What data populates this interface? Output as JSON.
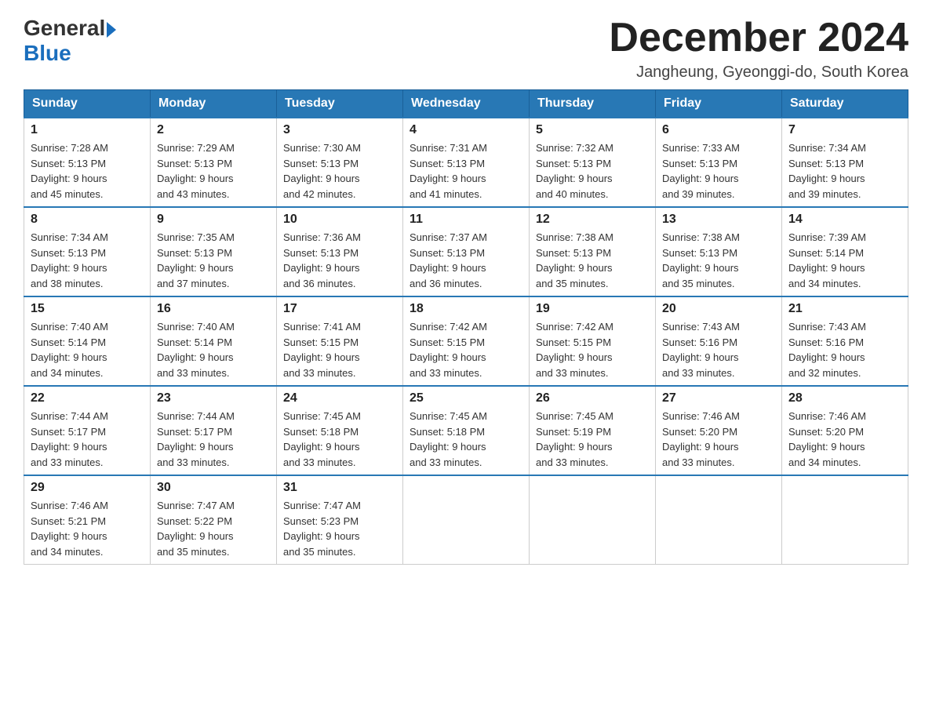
{
  "header": {
    "logo_general": "General",
    "logo_blue": "Blue",
    "month_title": "December 2024",
    "location": "Jangheung, Gyeonggi-do, South Korea"
  },
  "weekdays": [
    "Sunday",
    "Monday",
    "Tuesday",
    "Wednesday",
    "Thursday",
    "Friday",
    "Saturday"
  ],
  "weeks": [
    [
      {
        "day": "1",
        "sunrise": "7:28 AM",
        "sunset": "5:13 PM",
        "daylight": "9 hours and 45 minutes."
      },
      {
        "day": "2",
        "sunrise": "7:29 AM",
        "sunset": "5:13 PM",
        "daylight": "9 hours and 43 minutes."
      },
      {
        "day": "3",
        "sunrise": "7:30 AM",
        "sunset": "5:13 PM",
        "daylight": "9 hours and 42 minutes."
      },
      {
        "day": "4",
        "sunrise": "7:31 AM",
        "sunset": "5:13 PM",
        "daylight": "9 hours and 41 minutes."
      },
      {
        "day": "5",
        "sunrise": "7:32 AM",
        "sunset": "5:13 PM",
        "daylight": "9 hours and 40 minutes."
      },
      {
        "day": "6",
        "sunrise": "7:33 AM",
        "sunset": "5:13 PM",
        "daylight": "9 hours and 39 minutes."
      },
      {
        "day": "7",
        "sunrise": "7:34 AM",
        "sunset": "5:13 PM",
        "daylight": "9 hours and 39 minutes."
      }
    ],
    [
      {
        "day": "8",
        "sunrise": "7:34 AM",
        "sunset": "5:13 PM",
        "daylight": "9 hours and 38 minutes."
      },
      {
        "day": "9",
        "sunrise": "7:35 AM",
        "sunset": "5:13 PM",
        "daylight": "9 hours and 37 minutes."
      },
      {
        "day": "10",
        "sunrise": "7:36 AM",
        "sunset": "5:13 PM",
        "daylight": "9 hours and 36 minutes."
      },
      {
        "day": "11",
        "sunrise": "7:37 AM",
        "sunset": "5:13 PM",
        "daylight": "9 hours and 36 minutes."
      },
      {
        "day": "12",
        "sunrise": "7:38 AM",
        "sunset": "5:13 PM",
        "daylight": "9 hours and 35 minutes."
      },
      {
        "day": "13",
        "sunrise": "7:38 AM",
        "sunset": "5:13 PM",
        "daylight": "9 hours and 35 minutes."
      },
      {
        "day": "14",
        "sunrise": "7:39 AM",
        "sunset": "5:14 PM",
        "daylight": "9 hours and 34 minutes."
      }
    ],
    [
      {
        "day": "15",
        "sunrise": "7:40 AM",
        "sunset": "5:14 PM",
        "daylight": "9 hours and 34 minutes."
      },
      {
        "day": "16",
        "sunrise": "7:40 AM",
        "sunset": "5:14 PM",
        "daylight": "9 hours and 33 minutes."
      },
      {
        "day": "17",
        "sunrise": "7:41 AM",
        "sunset": "5:15 PM",
        "daylight": "9 hours and 33 minutes."
      },
      {
        "day": "18",
        "sunrise": "7:42 AM",
        "sunset": "5:15 PM",
        "daylight": "9 hours and 33 minutes."
      },
      {
        "day": "19",
        "sunrise": "7:42 AM",
        "sunset": "5:15 PM",
        "daylight": "9 hours and 33 minutes."
      },
      {
        "day": "20",
        "sunrise": "7:43 AM",
        "sunset": "5:16 PM",
        "daylight": "9 hours and 33 minutes."
      },
      {
        "day": "21",
        "sunrise": "7:43 AM",
        "sunset": "5:16 PM",
        "daylight": "9 hours and 32 minutes."
      }
    ],
    [
      {
        "day": "22",
        "sunrise": "7:44 AM",
        "sunset": "5:17 PM",
        "daylight": "9 hours and 33 minutes."
      },
      {
        "day": "23",
        "sunrise": "7:44 AM",
        "sunset": "5:17 PM",
        "daylight": "9 hours and 33 minutes."
      },
      {
        "day": "24",
        "sunrise": "7:45 AM",
        "sunset": "5:18 PM",
        "daylight": "9 hours and 33 minutes."
      },
      {
        "day": "25",
        "sunrise": "7:45 AM",
        "sunset": "5:18 PM",
        "daylight": "9 hours and 33 minutes."
      },
      {
        "day": "26",
        "sunrise": "7:45 AM",
        "sunset": "5:19 PM",
        "daylight": "9 hours and 33 minutes."
      },
      {
        "day": "27",
        "sunrise": "7:46 AM",
        "sunset": "5:20 PM",
        "daylight": "9 hours and 33 minutes."
      },
      {
        "day": "28",
        "sunrise": "7:46 AM",
        "sunset": "5:20 PM",
        "daylight": "9 hours and 34 minutes."
      }
    ],
    [
      {
        "day": "29",
        "sunrise": "7:46 AM",
        "sunset": "5:21 PM",
        "daylight": "9 hours and 34 minutes."
      },
      {
        "day": "30",
        "sunrise": "7:47 AM",
        "sunset": "5:22 PM",
        "daylight": "9 hours and 35 minutes."
      },
      {
        "day": "31",
        "sunrise": "7:47 AM",
        "sunset": "5:23 PM",
        "daylight": "9 hours and 35 minutes."
      },
      null,
      null,
      null,
      null
    ]
  ],
  "labels": {
    "sunrise": "Sunrise:",
    "sunset": "Sunset:",
    "daylight": "Daylight:"
  }
}
